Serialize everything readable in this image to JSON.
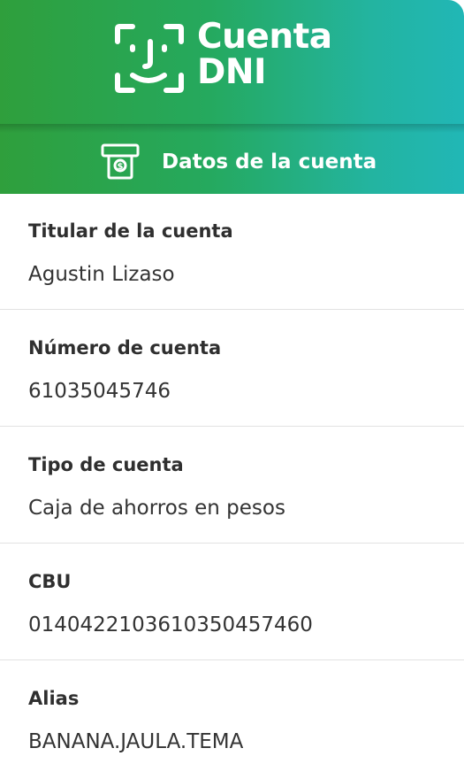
{
  "header": {
    "logo_line1": "Cuenta",
    "logo_line2": "DNI",
    "logo_icon": "face-scan-icon",
    "section_icon": "atm-cash-icon",
    "section_title": "Datos de la cuenta"
  },
  "fields": [
    {
      "label": "Titular de la cuenta",
      "value": "Agustin Lizaso"
    },
    {
      "label": "Número de cuenta",
      "value": "61035045746"
    },
    {
      "label": "Tipo de cuenta",
      "value": "Caja de ahorros en pesos"
    },
    {
      "label": "CBU",
      "value": "0140422103610350457460"
    },
    {
      "label": "Alias",
      "value": "BANANA.JAULA.TEMA"
    }
  ],
  "colors": {
    "gradient_start": "#2f9f3c",
    "gradient_end": "#21b7b6",
    "text_dark": "#333333",
    "divider": "#e2e2e2"
  }
}
